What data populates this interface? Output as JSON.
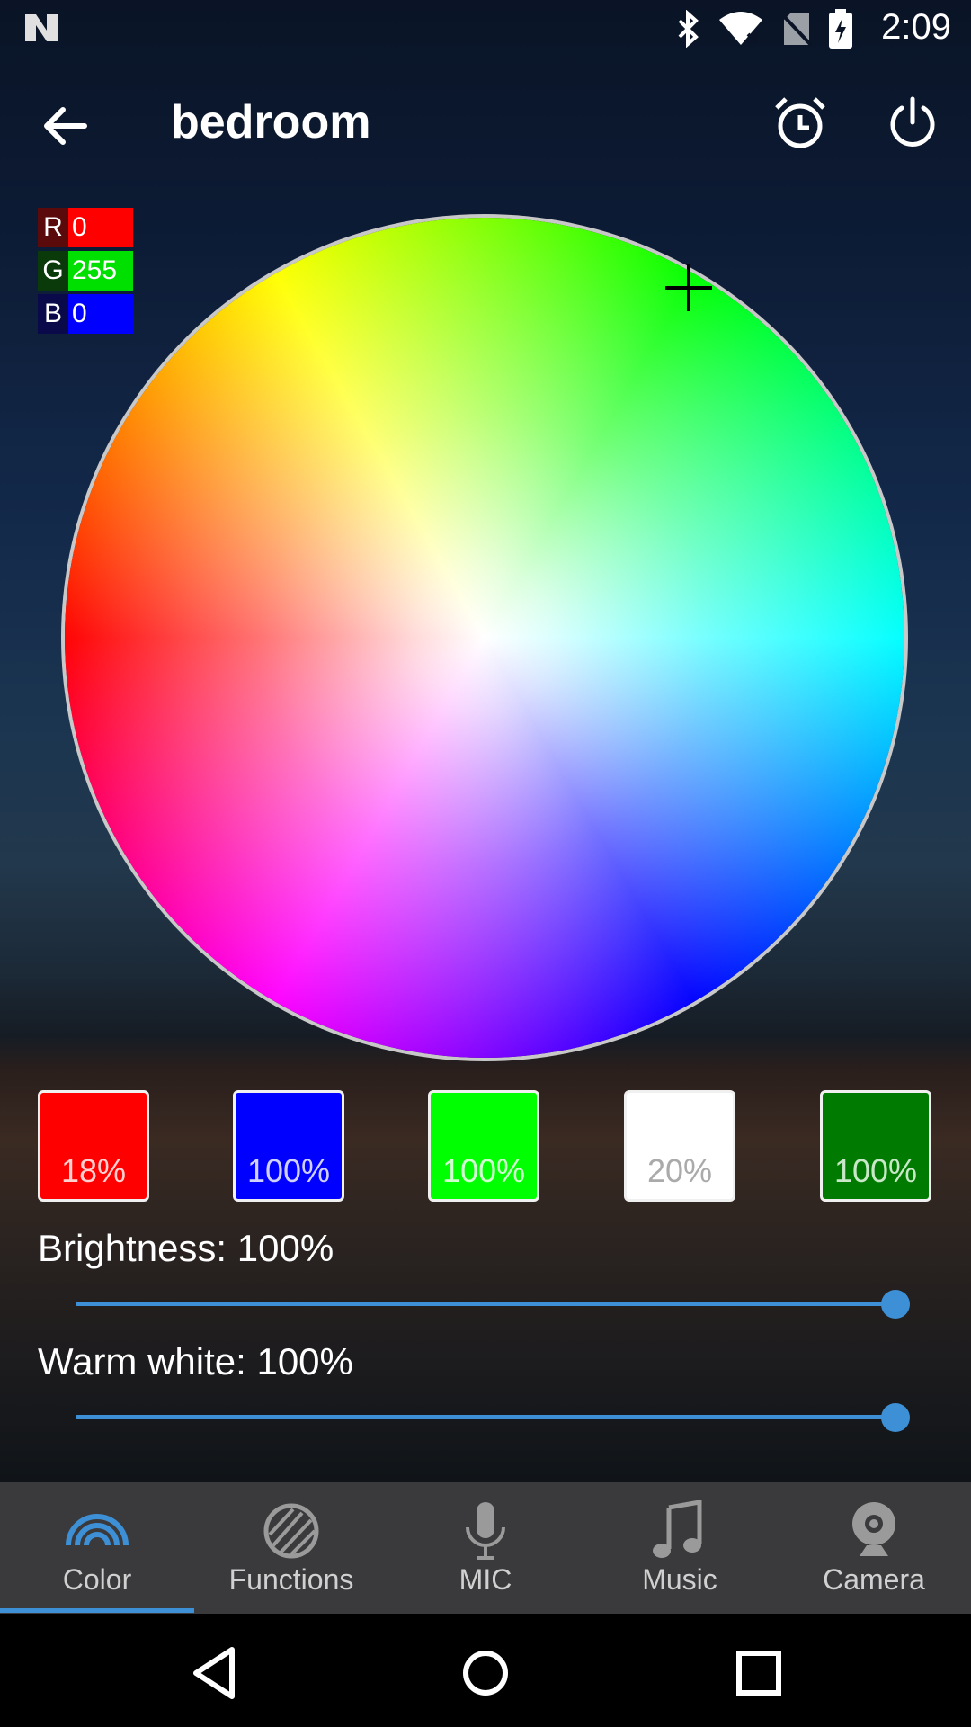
{
  "status_bar": {
    "time": "2:09",
    "icons": [
      "n-logo-icon",
      "bluetooth-icon",
      "wifi-icon",
      "no-sim-icon",
      "battery-charging-icon"
    ]
  },
  "app_bar": {
    "title": "bedroom",
    "icons": [
      "back-arrow-icon",
      "alarm-clock-icon",
      "power-icon"
    ]
  },
  "rgb": [
    {
      "letter": "R",
      "value": "0",
      "color": "#ff0000",
      "letter_bg": "#5a0a0a"
    },
    {
      "letter": "G",
      "value": "255",
      "color": "#00e000",
      "letter_bg": "#0a3a0a"
    },
    {
      "letter": "B",
      "value": "0",
      "color": "#0000ff",
      "letter_bg": "#0a0a4a"
    }
  ],
  "swatches": [
    {
      "label": "18%",
      "color": "#ff0000",
      "text_color": "#ffd0d0"
    },
    {
      "label": "100%",
      "color": "#0000ff",
      "text_color": "#d0d0ff"
    },
    {
      "label": "100%",
      "color": "#00ff00",
      "text_color": "#d0ffd0"
    },
    {
      "label": "20%",
      "color": "#ffffff",
      "text_color": "#aaaaaa"
    },
    {
      "label": "100%",
      "color": "#007a00",
      "text_color": "#c8e8c8"
    }
  ],
  "brightness": {
    "label": "Brightness: 100%",
    "value": 1.0
  },
  "warm_white": {
    "label": "Warm white: 100%",
    "value": 1.0
  },
  "bottom_nav": [
    {
      "label": "Color",
      "icon": "rainbow-icon",
      "active": true
    },
    {
      "label": "Functions",
      "icon": "functions-stripes-icon",
      "active": false
    },
    {
      "label": "MIC",
      "icon": "microphone-icon",
      "active": false
    },
    {
      "label": "Music",
      "icon": "music-note-icon",
      "active": false
    },
    {
      "label": "Camera",
      "icon": "webcam-icon",
      "active": false
    }
  ],
  "accent_color": "#3d8fd6"
}
